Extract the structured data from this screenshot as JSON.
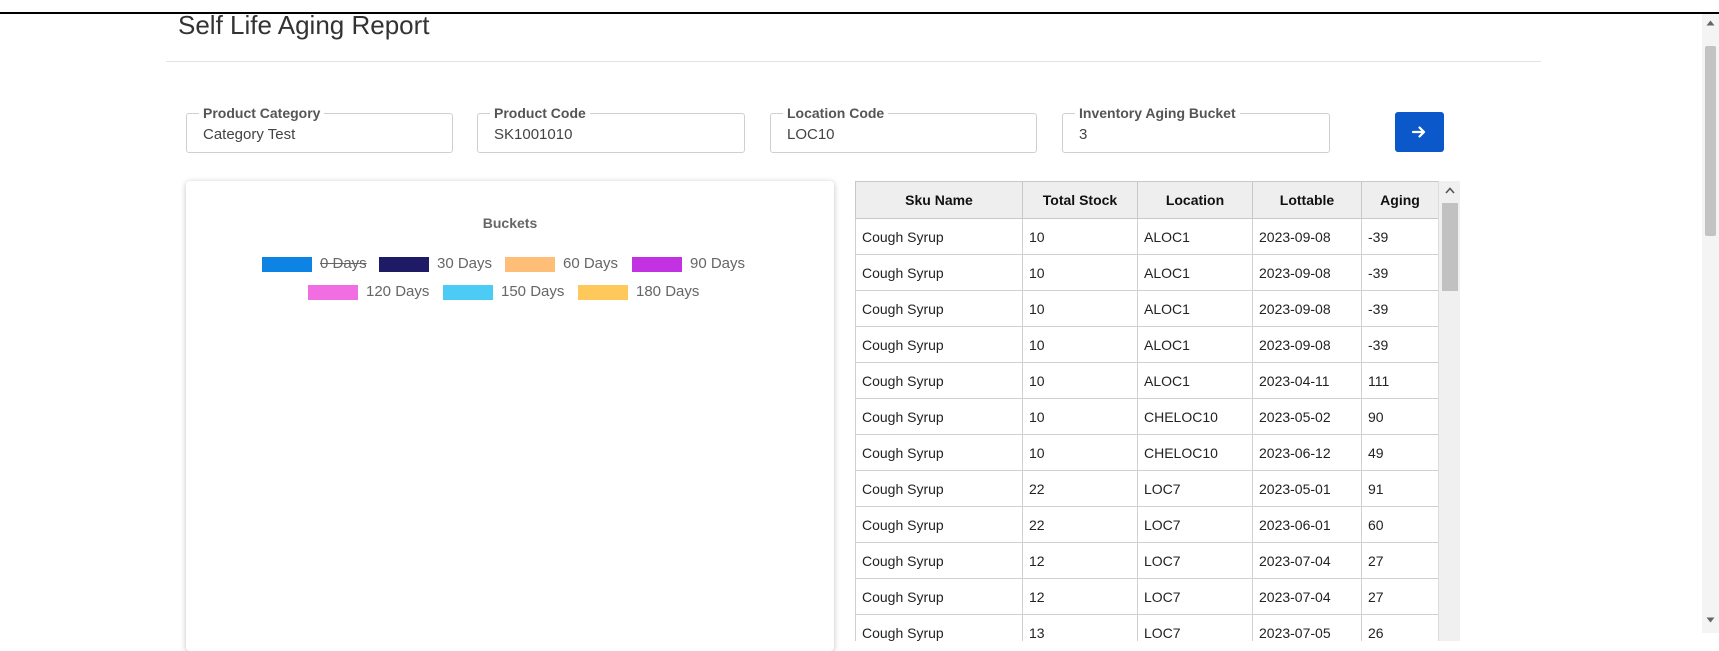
{
  "page": {
    "title": "Self Life Aging Report"
  },
  "filters": [
    {
      "label": "Product Category",
      "value": "Category Test"
    },
    {
      "label": "Product Code",
      "value": "SK1001010"
    },
    {
      "label": "Location Code",
      "value": "LOC10"
    },
    {
      "label": "Inventory Aging Bucket",
      "value": "3"
    }
  ],
  "actions": {
    "go_icon": "arrow-right-icon",
    "accent": "#0a58ca"
  },
  "chart_data": {
    "type": "bar",
    "title": "Buckets",
    "legend_position": "top",
    "series": [
      {
        "name": "0 Days",
        "color": "#0d84e3",
        "hidden": true
      },
      {
        "name": "30 Days",
        "color": "#1e1a66",
        "hidden": false
      },
      {
        "name": "60 Days",
        "color": "#ffbe78",
        "hidden": false
      },
      {
        "name": "90 Days",
        "color": "#c232e3",
        "hidden": false
      },
      {
        "name": "120 Days",
        "color": "#f06ee2",
        "hidden": false
      },
      {
        "name": "150 Days",
        "color": "#4ccbf5",
        "hidden": false
      },
      {
        "name": "180 Days",
        "color": "#ffc85a",
        "hidden": false
      }
    ]
  },
  "table": {
    "columns": [
      "Sku Name",
      "Total Stock",
      "Location",
      "Lottable",
      "Aging"
    ],
    "rows": [
      [
        "Cough Syrup",
        "10",
        "ALOC1",
        "2023-09-08",
        "-39"
      ],
      [
        "Cough Syrup",
        "10",
        "ALOC1",
        "2023-09-08",
        "-39"
      ],
      [
        "Cough Syrup",
        "10",
        "ALOC1",
        "2023-09-08",
        "-39"
      ],
      [
        "Cough Syrup",
        "10",
        "ALOC1",
        "2023-09-08",
        "-39"
      ],
      [
        "Cough Syrup",
        "10",
        "ALOC1",
        "2023-04-11",
        "111"
      ],
      [
        "Cough Syrup",
        "10",
        "CHELOC10",
        "2023-05-02",
        "90"
      ],
      [
        "Cough Syrup",
        "10",
        "CHELOC10",
        "2023-06-12",
        "49"
      ],
      [
        "Cough Syrup",
        "22",
        "LOC7",
        "2023-05-01",
        "91"
      ],
      [
        "Cough Syrup",
        "22",
        "LOC7",
        "2023-06-01",
        "60"
      ],
      [
        "Cough Syrup",
        "12",
        "LOC7",
        "2023-07-04",
        "27"
      ],
      [
        "Cough Syrup",
        "12",
        "LOC7",
        "2023-07-04",
        "27"
      ],
      [
        "Cough Syrup",
        "13",
        "LOC7",
        "2023-07-05",
        "26"
      ]
    ]
  }
}
